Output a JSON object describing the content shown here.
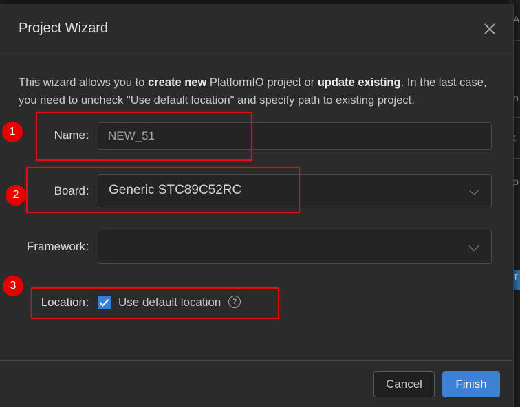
{
  "dialog": {
    "title": "Project Wizard",
    "intro": {
      "part1": "This wizard allows you to ",
      "bold1": "create new",
      "part2": " PlatformIO project or ",
      "bold2": "update existing",
      "part3": ". In the last case, you need to uncheck \"Use default location\" and specify path to existing project."
    },
    "name": {
      "label": "Name",
      "value": "NEW_51"
    },
    "board": {
      "label": "Board",
      "value": "Generic STC89C52RC"
    },
    "framework": {
      "label": "Framework",
      "value": ""
    },
    "location": {
      "label": "Location",
      "checkbox_label": "Use default location",
      "checked": true,
      "help": "?"
    },
    "buttons": {
      "cancel": "Cancel",
      "finish": "Finish"
    }
  },
  "annotations": {
    "badge1": "1",
    "badge2": "2",
    "badge3": "3"
  },
  "background": {
    "ghost1": "A",
    "ghost2": "n",
    "ghost3": "t",
    "ghost4": "p",
    "ghost5": "T"
  },
  "colors": {
    "accent": "#3d82d8",
    "annotation": "#e01010",
    "dialog_bg": "#2b2b2b"
  },
  "separator": ":"
}
